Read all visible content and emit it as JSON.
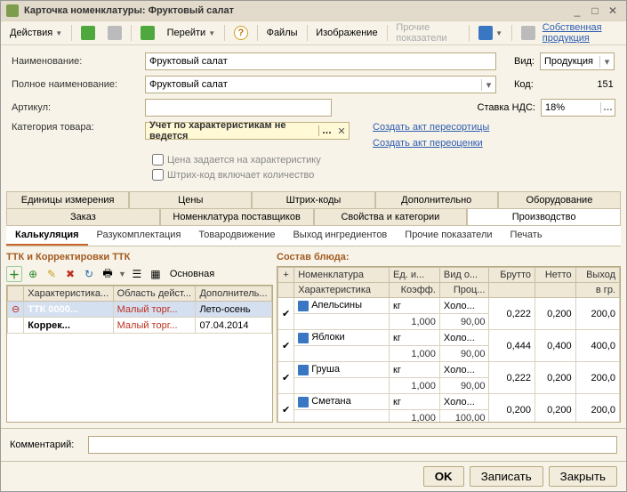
{
  "window": {
    "title": "Карточка номенклатуры: Фруктовый салат"
  },
  "toolbar": {
    "actions": "Действия",
    "goto": "Перейти",
    "files": "Файлы",
    "image": "Изображение",
    "other": "Прочие показатели",
    "own_product": "Собственная продукция"
  },
  "form": {
    "name_lbl": "Наименование:",
    "name_val": "Фруктовый салат",
    "fullname_lbl": "Полное наименование:",
    "fullname_val": "Фруктовый салат",
    "article_lbl": "Артикул:",
    "article_val": "",
    "category_lbl": "Категория товара:",
    "category_val": "Учет по характеристикам не ведется",
    "vid_lbl": "Вид:",
    "vid_val": "Продукция",
    "code_lbl": "Код:",
    "code_val": "151",
    "vat_lbl": "Ставка НДС:",
    "vat_val": "18%",
    "price_check": "Цена задается на характеристику",
    "barcode_check": "Штрих-код включает количество",
    "link_resort": "Создать акт пересортицы",
    "link_reprice": "Создать акт переоценки"
  },
  "tabs1": {
    "row1": [
      "Единицы измерения",
      "Цены",
      "Штрих-коды",
      "Дополнительно",
      "Оборудование"
    ],
    "row2": [
      "Заказ",
      "Номенклатура поставщиков",
      "Свойства и категории",
      "Производство"
    ],
    "active": "Производство"
  },
  "tabs2": {
    "items": [
      "Калькуляция",
      "Разукомплектация",
      "Товародвижение",
      "Выход ингредиентов",
      "Прочие показатели",
      "Печать"
    ],
    "active": "Калькуляция"
  },
  "left_panel": {
    "title": "ТТК и Корректировки ТТК",
    "main_label": "Основная",
    "columns": [
      "Характеристика...",
      "Область дейст...",
      "Дополнитель..."
    ],
    "rows": [
      {
        "c1": "ТТК 0000...",
        "c2": "Малый торг...",
        "c3": "Лето-осень",
        "selected": true
      },
      {
        "c1": "Коррек...",
        "c2": "Малый торг...",
        "c3": "07.04.2014",
        "selected": false
      }
    ]
  },
  "right_panel": {
    "title": "Состав блюда:",
    "header1": [
      "",
      "Номенклатура",
      "Ед. и...",
      "Вид о...",
      "Брутто",
      "Нетто",
      "Выход"
    ],
    "header2": [
      "Характеристика",
      "Коэфф.",
      "Проц...",
      "",
      "",
      "в гр."
    ],
    "rows": [
      {
        "chk": true,
        "name": "Апельсины",
        "unit": "кг",
        "kind": "Холо...",
        "brutto": "0,222",
        "netto": "0,200",
        "out": "200,0",
        "coef": "1,000",
        "perc": "90,00"
      },
      {
        "chk": true,
        "name": "Яблоки",
        "unit": "кг",
        "kind": "Холо...",
        "brutto": "0,444",
        "netto": "0,400",
        "out": "400,0",
        "coef": "1,000",
        "perc": "90,00"
      },
      {
        "chk": true,
        "name": "Груша",
        "unit": "кг",
        "kind": "Холо...",
        "brutto": "0,222",
        "netto": "0,200",
        "out": "200,0",
        "coef": "1,000",
        "perc": "90,00"
      },
      {
        "chk": true,
        "name": "Сметана",
        "unit": "кг",
        "kind": "Холо...",
        "brutto": "0,200",
        "netto": "0,200",
        "out": "200,0",
        "coef": "1,000",
        "perc": "100,00"
      }
    ]
  },
  "bottom": {
    "comment_lbl": "Комментарий:"
  },
  "footer": {
    "ok": "OK",
    "save": "Записать",
    "close": "Закрыть"
  }
}
